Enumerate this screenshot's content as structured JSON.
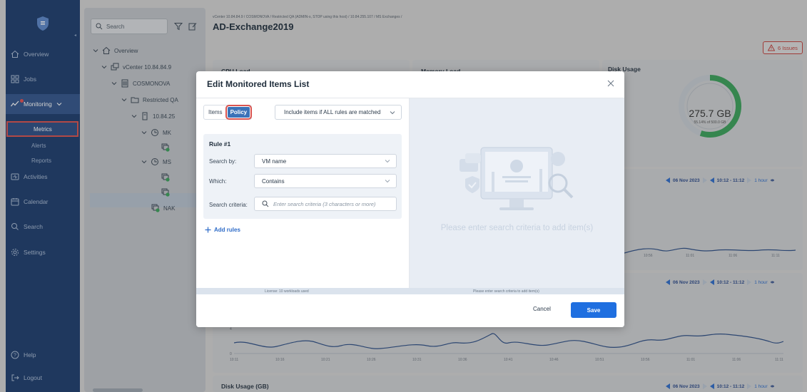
{
  "nav": {
    "items": [
      {
        "label": "Overview",
        "icon": "home-icon"
      },
      {
        "label": "Jobs",
        "icon": "grid-icon"
      },
      {
        "label": "Monitoring",
        "icon": "pulse-icon"
      },
      {
        "label": "Activities",
        "icon": "activity-icon"
      },
      {
        "label": "Calendar",
        "icon": "calendar-icon"
      },
      {
        "label": "Search",
        "icon": "search-icon"
      },
      {
        "label": "Settings",
        "icon": "gear-icon"
      }
    ],
    "monitoring_sub": [
      "Metrics",
      "Alerts",
      "Reports"
    ],
    "help": "Help",
    "logout": "Logout"
  },
  "tree": {
    "search_placeholder": "Search",
    "rows": [
      {
        "label": "Overview"
      },
      {
        "label": "vCenter 10.84.84.9"
      },
      {
        "label": "COSMONOVA"
      },
      {
        "label": "Restricted QA"
      },
      {
        "label": "10.84.25"
      },
      {
        "label": "MK"
      },
      {
        "label": "MS"
      },
      {
        "label": "NAK"
      }
    ]
  },
  "main": {
    "breadcrumb": "vCenter 10.84.84.9 / COSMONOVA / Restricted QA (ADMIN-s, STOP using this host) / 10.84.255.107 / MS Exchanges /",
    "title": "AD-Exchange2019",
    "issues": "6 Issues",
    "cards": {
      "cpu": "CPU Load",
      "memory": "Memory Load",
      "disk": "Disk Usage",
      "disk_gb": "Disk Usage (GB)"
    },
    "disk_value": "275.7 GB",
    "disk_sub": "55.14% of 500.0 GB",
    "time": {
      "date": "06 Nov 2023",
      "range": "10:12 - 11:12",
      "period": "1 hour"
    },
    "x_ticks": [
      "10:11",
      "10:16",
      "10:21",
      "10:26",
      "10:31",
      "10:36",
      "10:41",
      "10:46",
      "10:51",
      "10:56",
      "11:01",
      "11:06",
      "11:11"
    ],
    "y_ticks": [
      "4",
      "0"
    ]
  },
  "modal": {
    "title": "Edit Monitored Items List",
    "tabs": [
      "Items",
      "Policy"
    ],
    "match_select": "Include items if ALL rules are matched",
    "rule_title": "Rule #1",
    "search_by_label": "Search by:",
    "search_by_value": "VM name",
    "which_label": "Which:",
    "which_value": "Contains",
    "criteria_label": "Search criteria:",
    "criteria_placeholder": "Enter search criteria (3 characters or more)",
    "add_rules": "Add rules",
    "empty_message": "Please enter search criteria to add item(s)",
    "license": "License: 10 workloads used",
    "status_right": "Please enter search criteria to add item(s)",
    "cancel": "Cancel",
    "save": "Save"
  },
  "colors": {
    "nav_bg": "#1d3d6e",
    "accent": "#1f6fe0",
    "danger": "#d9534f",
    "gauge": "#3aa05a"
  }
}
